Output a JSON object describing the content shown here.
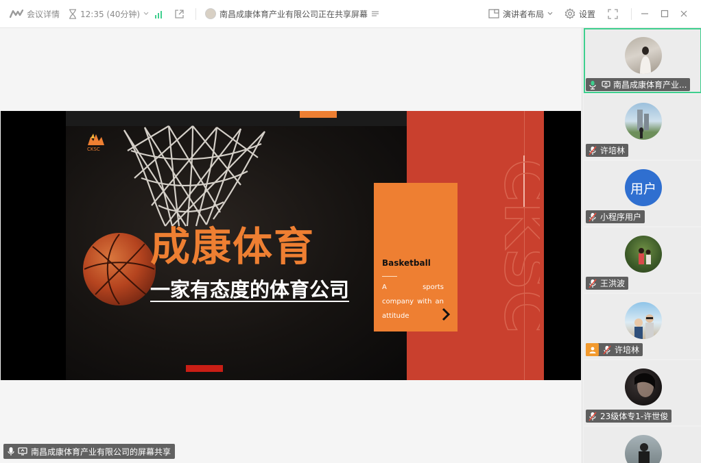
{
  "toolbar": {
    "meeting_details": "会议详情",
    "timer": "12:35 (40分钟)",
    "sharing_status": "南昌成康体育产业有限公司正在共享屏幕",
    "layout_label": "演讲者布局",
    "settings_label": "设置"
  },
  "slide": {
    "brand_logo_text": "CKSC",
    "headline": "成康体育",
    "subline": "一家有态度的体育公司",
    "card_title": "Basketball",
    "card_text": "A sports company with an attitude",
    "ghost_text": "CKSC"
  },
  "stage": {
    "share_label": "南昌成康体育产业有限公司的屏幕共享"
  },
  "participants": [
    {
      "name": "南昌成康体育产业...",
      "avatar": "photo",
      "active": true
    },
    {
      "name": "许培林",
      "avatar": "photo"
    },
    {
      "name": "小程序用户",
      "avatar": "text",
      "avatar_text": "用户"
    },
    {
      "name": "王洪波",
      "avatar": "photo"
    },
    {
      "name": "许培林",
      "avatar": "photo",
      "host": true
    },
    {
      "name": "23级体专1-许世俊",
      "avatar": "photo"
    },
    {
      "name": "",
      "avatar": "photo"
    }
  ],
  "colors": {
    "accent_orange": "#ee7f32",
    "accent_red": "#c9402e",
    "active_border": "#3ecf8e",
    "avatar_blue": "#2f6fd0"
  }
}
